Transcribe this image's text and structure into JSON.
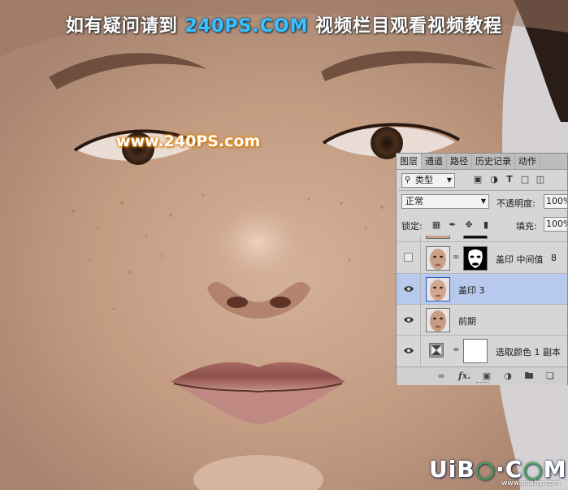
{
  "banner": {
    "prefix": "如有疑问请到",
    "site": "240PS.COM",
    "suffix": "视频栏目观看视频教程"
  },
  "watermark": "www.240PS.com",
  "logo": {
    "part1": "UiB",
    "o": "○",
    "part2": "·C",
    "part3": "M",
    "sub": "www.psahz.com"
  },
  "panel": {
    "tabs": [
      "图层",
      "通道",
      "路径",
      "历史记录",
      "动作"
    ],
    "filter": {
      "label": "类型",
      "search_icon": "magnifier-icon"
    },
    "filter_icons": [
      "image-filter-icon",
      "adjustment-filter-icon",
      "type-filter-icon",
      "shape-filter-icon",
      "smart-object-filter-icon"
    ],
    "blend_mode": "正常",
    "opacity_label": "不透明度:",
    "opacity_value": "100%",
    "lock_label": "锁定:",
    "lock_icons": [
      "lock-transparent-icon",
      "lock-pixels-icon",
      "lock-position-icon",
      "lock-all-icon"
    ],
    "fill_label": "填充:",
    "fill_value": "100%",
    "layers": [
      {
        "name": "盖印 中间值",
        "extra": "8",
        "visible": false,
        "has_mask": true,
        "selected": false
      },
      {
        "name": "盖印 3",
        "extra": "",
        "visible": true,
        "has_mask": false,
        "selected": true
      },
      {
        "name": "前期",
        "extra": "",
        "visible": true,
        "has_mask": false,
        "selected": false
      },
      {
        "name": "选取颜色 1 副本",
        "extra": "",
        "visible": true,
        "has_mask": true,
        "selected": false
      }
    ],
    "bottom_icons": [
      "link-layers-icon",
      "fx-icon",
      "add-mask-icon",
      "adjustment-layer-icon",
      "group-folder-icon",
      "new-layer-icon"
    ]
  },
  "colors": {
    "accent_blue": "#39c3ff",
    "watermark_glow": "#e88a10",
    "selected_layer": "#b7c9ec",
    "panel_bg": "#d6d6d6"
  }
}
